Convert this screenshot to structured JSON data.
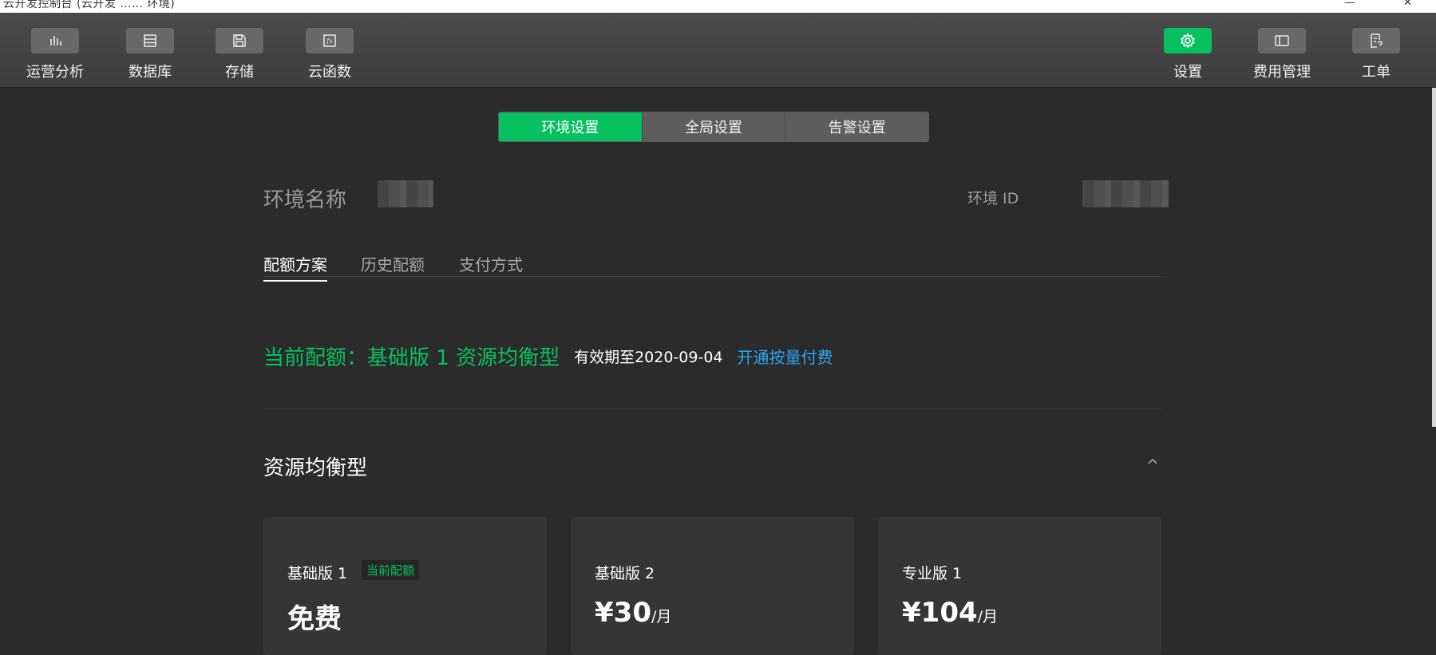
{
  "window": {
    "title": "云开发控制台 (云开发 …… 环境)",
    "controls": [
      "—",
      "✕"
    ]
  },
  "toolbar": {
    "left": [
      {
        "label": "运营分析",
        "icon": "bar-chart-icon"
      },
      {
        "label": "数据库",
        "icon": "database-icon"
      },
      {
        "label": "存储",
        "icon": "storage-icon"
      },
      {
        "label": "云函数",
        "icon": "function-icon"
      }
    ],
    "right": [
      {
        "label": "设置",
        "icon": "gear-icon",
        "active": true
      },
      {
        "label": "费用管理",
        "icon": "billing-icon"
      },
      {
        "label": "工单",
        "icon": "ticket-icon"
      }
    ]
  },
  "segments": [
    {
      "label": "环境设置",
      "active": true
    },
    {
      "label": "全局设置"
    },
    {
      "label": "告警设置"
    }
  ],
  "env": {
    "name_label": "环境名称",
    "id_label": "环境 ID"
  },
  "tabs": [
    {
      "label": "配额方案",
      "active": true
    },
    {
      "label": "历史配额"
    },
    {
      "label": "支付方式"
    }
  ],
  "quota": {
    "current": "当前配额：基础版 1 资源均衡型",
    "valid_until": "有效期至2020-09-04",
    "open_link": "开通按量付费"
  },
  "section": {
    "title": "资源均衡型"
  },
  "plans": [
    {
      "name": "基础版 1",
      "badge": "当前配额",
      "price": "免费",
      "unit": ""
    },
    {
      "name": "基础版 2",
      "price": "¥30",
      "unit": "/月"
    },
    {
      "name": "专业版 1",
      "price": "¥104",
      "unit": "/月"
    }
  ],
  "colors": {
    "accent": "#07c160",
    "link": "#2aa6f2",
    "background": "#2b2b2b"
  }
}
